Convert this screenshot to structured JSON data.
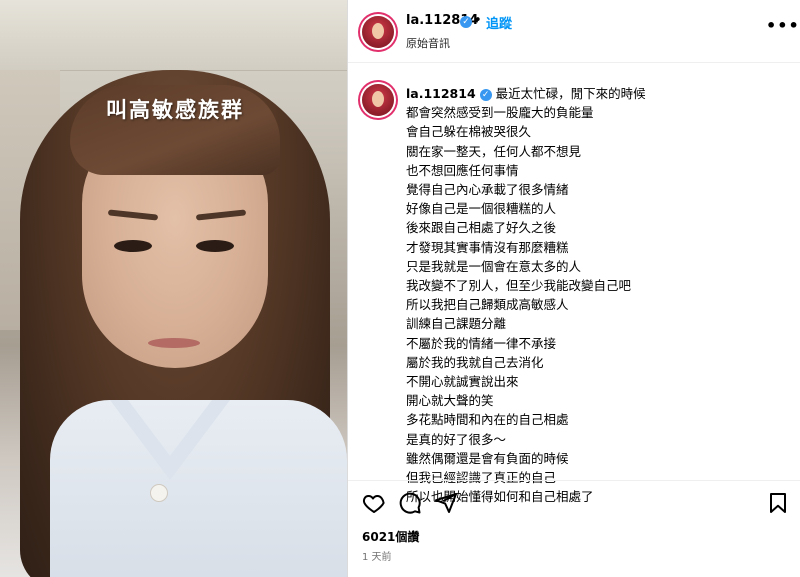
{
  "video": {
    "overlay_text": "叫高敏感族群"
  },
  "post": {
    "username": "la.112814",
    "follow_label": "追蹤",
    "separator": "•",
    "audio_label": "原始音訊",
    "more_label": "•••",
    "caption_lines": [
      "最近太忙碌，閒下來的時候",
      "都會突然感受到一股龐大的負能量",
      "會自己躲在棉被哭很久",
      "關在家一整天，任何人都不想見",
      "也不想回應任何事情",
      "覺得自己內心承載了很多情緒",
      "好像自己是一個很糟糕的人",
      "後來跟自己相處了好久之後",
      "才發現其實事情沒有那麼糟糕",
      "只是我就是一個會在意太多的人",
      "我改變不了別人，但至少我能改變自己吧",
      "所以我把自己歸類成高敏感人",
      "訓練自己課題分離",
      "不屬於我的情緒一律不承接",
      "屬於我的我就自己去消化",
      "不開心就誠實說出來",
      "開心就大聲的笑",
      "多花點時間和內在的自己相處",
      "是真的好了很多～",
      "雖然偶爾還是會有負面的時候",
      "但我已經認識了真正的自己",
      "所以也開始懂得如何和自己相處了"
    ],
    "views": "6021個讚",
    "time": "1 天前"
  },
  "icons": {
    "like": "heart-icon",
    "comment": "comment-icon",
    "share": "share-icon",
    "save": "bookmark-icon",
    "verified": "verified-icon"
  }
}
